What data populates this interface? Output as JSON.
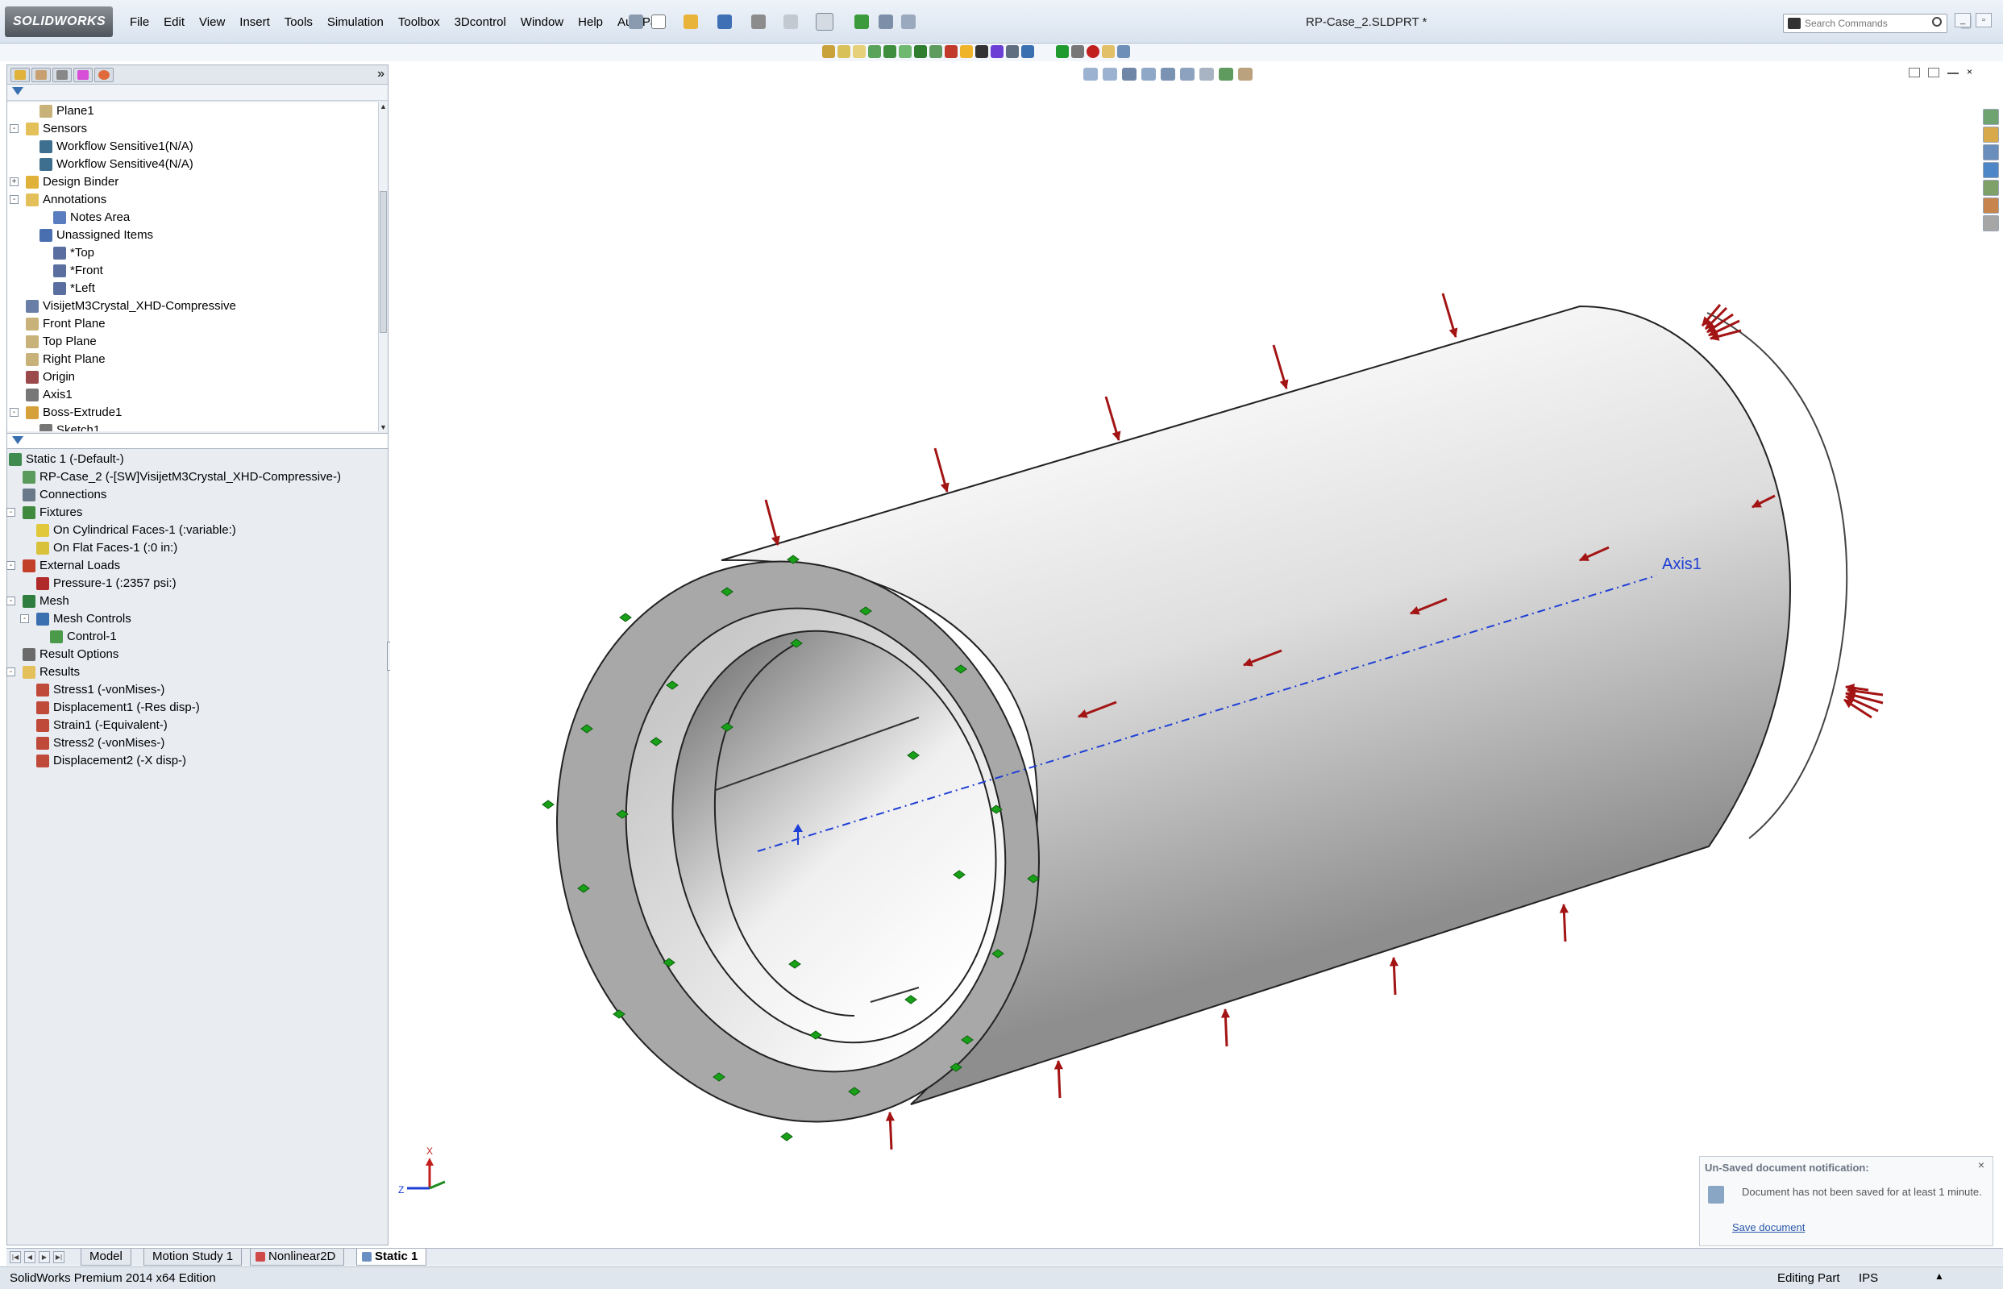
{
  "app": {
    "logo_text": "SOLIDWORKS",
    "document_title": "RP-Case_2.SLDPRT *"
  },
  "menu": [
    "File",
    "Edit",
    "View",
    "Insert",
    "Tools",
    "Simulation",
    "Toolbox",
    "3Dcontrol",
    "Window",
    "Help",
    "AutoPart"
  ],
  "search": {
    "placeholder": "Search Commands"
  },
  "colors": {
    "load_arrow": "#a31414",
    "fixture": "#18a018",
    "axis": "#1e3fd6",
    "part_face": "#a8a8a8"
  },
  "feature_tree": [
    {
      "label": "Plane1",
      "indent": 2,
      "icon": "plane-icon"
    },
    {
      "label": "Sensors",
      "indent": 1,
      "icon": "sensors-folder-icon",
      "expander": "-"
    },
    {
      "label": "Workflow Sensitive1(N/A)",
      "indent": 2,
      "icon": "sensor-icon"
    },
    {
      "label": "Workflow Sensitive4(N/A)",
      "indent": 2,
      "icon": "sensor-icon"
    },
    {
      "label": "Design Binder",
      "indent": 1,
      "icon": "design-binder-icon",
      "expander": "+"
    },
    {
      "label": "Annotations",
      "indent": 1,
      "icon": "annotations-folder-icon",
      "expander": "-"
    },
    {
      "label": "Notes Area",
      "indent": 3,
      "icon": "notes-area-icon"
    },
    {
      "label": "Unassigned Items",
      "indent": 2,
      "icon": "unassigned-items-icon"
    },
    {
      "label": "*Top",
      "indent": 3,
      "icon": "annotation-view-icon"
    },
    {
      "label": "*Front",
      "indent": 3,
      "icon": "annotation-view-icon"
    },
    {
      "label": "*Left",
      "indent": 3,
      "icon": "annotation-view-icon"
    },
    {
      "label": "VisijetM3Crystal_XHD-Compressive",
      "indent": 1,
      "icon": "material-icon"
    },
    {
      "label": "Front Plane",
      "indent": 1,
      "icon": "plane-icon"
    },
    {
      "label": "Top Plane",
      "indent": 1,
      "icon": "plane-icon"
    },
    {
      "label": "Right Plane",
      "indent": 1,
      "icon": "plane-icon"
    },
    {
      "label": "Origin",
      "indent": 1,
      "icon": "origin-icon"
    },
    {
      "label": "Axis1",
      "indent": 1,
      "icon": "axis-icon"
    },
    {
      "label": "Boss-Extrude1",
      "indent": 1,
      "icon": "boss-extrude-icon",
      "expander": "-"
    },
    {
      "label": "Sketch1",
      "indent": 2,
      "icon": "sketch-icon"
    }
  ],
  "simulation_tree": [
    {
      "label": "Static 1 (-Default-)",
      "indent": 0,
      "icon": "static-study-icon"
    },
    {
      "label": "RP-Case_2 (-[SW]VisijetM3Crystal_XHD-Compressive-)",
      "indent": 1,
      "icon": "part-icon"
    },
    {
      "label": "Connections",
      "indent": 1,
      "icon": "connections-icon"
    },
    {
      "label": "Fixtures",
      "indent": 1,
      "icon": "fixtures-icon",
      "expander": "-"
    },
    {
      "label": "On Cylindrical Faces-1 (:variable:)",
      "indent": 2,
      "icon": "cylindrical-fixture-icon"
    },
    {
      "label": "On Flat Faces-1 (:0 in:)",
      "indent": 2,
      "icon": "flat-fixture-icon"
    },
    {
      "label": "External Loads",
      "indent": 1,
      "icon": "external-loads-icon",
      "expander": "-"
    },
    {
      "label": "Pressure-1 (:2357 psi:)",
      "indent": 2,
      "icon": "pressure-icon"
    },
    {
      "label": "Mesh",
      "indent": 1,
      "icon": "mesh-icon",
      "expander": "-"
    },
    {
      "label": "Mesh Controls",
      "indent": 2,
      "icon": "mesh-controls-icon",
      "expander": "-"
    },
    {
      "label": "Control-1",
      "indent": 3,
      "icon": "mesh-control-icon"
    },
    {
      "label": "Result Options",
      "indent": 1,
      "icon": "result-options-icon"
    },
    {
      "label": "Results",
      "indent": 1,
      "icon": "results-folder-icon",
      "expander": "-"
    },
    {
      "label": "Stress1 (-vonMises-)",
      "indent": 2,
      "icon": "plot-icon"
    },
    {
      "label": "Displacement1 (-Res disp-)",
      "indent": 2,
      "icon": "plot-icon"
    },
    {
      "label": "Strain1 (-Equivalent-)",
      "indent": 2,
      "icon": "plot-icon"
    },
    {
      "label": "Stress2 (-vonMises-)",
      "indent": 2,
      "icon": "plot-icon"
    },
    {
      "label": "Displacement2 (-X disp-)",
      "indent": 2,
      "icon": "plot-icon"
    }
  ],
  "viewport": {
    "axis_label": "Axis1",
    "triad": {
      "x": "X",
      "z": "Z"
    }
  },
  "notification": {
    "title": "Un-Saved document notification:",
    "message": "Document has not been saved for at least 1 minute.",
    "action": "Save document",
    "close": "×"
  },
  "bottom_tabs": [
    {
      "label": "Model",
      "active": false
    },
    {
      "label": "Motion Study 1",
      "active": false
    },
    {
      "label": "Nonlinear2D",
      "active": false
    },
    {
      "label": "Static 1",
      "active": true
    }
  ],
  "status": {
    "edition": "SolidWorks Premium 2014 x64 Edition",
    "mode": "Editing Part",
    "units": "IPS",
    "units_arrow": "▲"
  }
}
